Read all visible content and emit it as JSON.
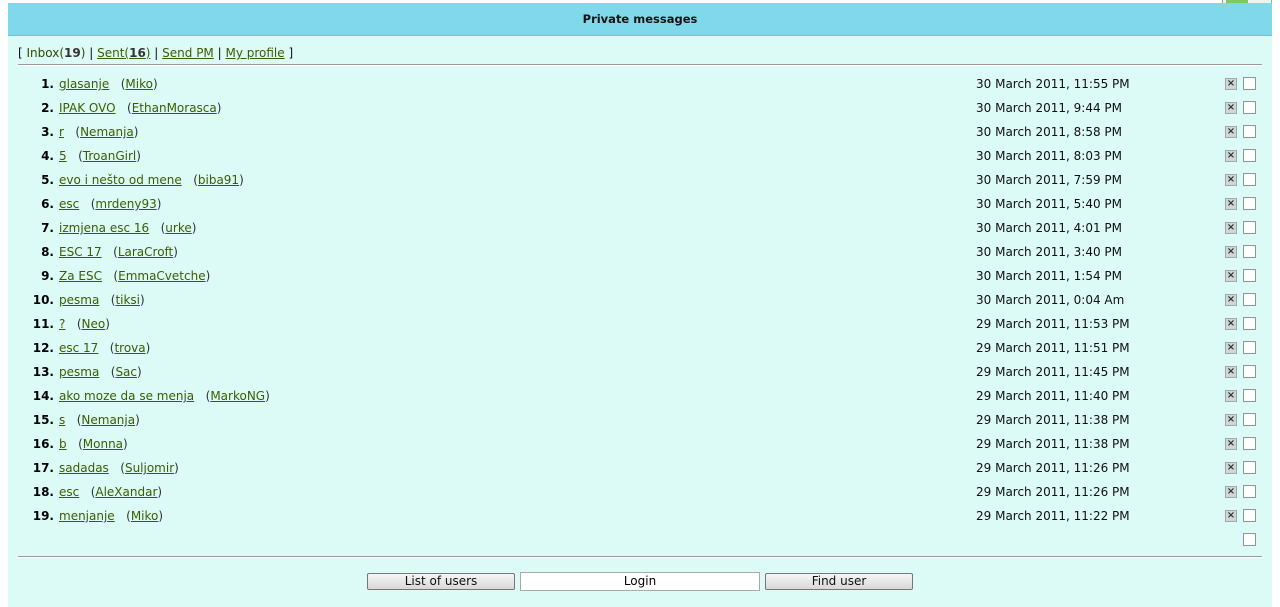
{
  "header": {
    "title": "Private messages"
  },
  "nav": {
    "inbox_label": "Inbox",
    "inbox_count": "19",
    "sent_label": "Sent",
    "sent_count": "16",
    "send_pm": "Send PM",
    "my_profile": "My profile"
  },
  "messages": [
    {
      "num": "1.",
      "subject": "glasanje",
      "sender": "Miko",
      "date": "30 March 2011, 11:55 PM"
    },
    {
      "num": "2.",
      "subject": "IPAK OVO",
      "sender": "EthanMorasca",
      "date": "30 March 2011, 9:44 PM"
    },
    {
      "num": "3.",
      "subject": "r",
      "sender": "Nemanja",
      "date": "30 March 2011, 8:58 PM"
    },
    {
      "num": "4.",
      "subject": "5",
      "sender": "TroanGirl",
      "date": "30 March 2011, 8:03 PM"
    },
    {
      "num": "5.",
      "subject": "evo i nešto od mene",
      "sender": "biba91",
      "date": "30 March 2011, 7:59 PM"
    },
    {
      "num": "6.",
      "subject": "esc",
      "sender": "mrdeny93",
      "date": "30 March 2011, 5:40 PM"
    },
    {
      "num": "7.",
      "subject": "izmjena esc 16",
      "sender": "urke",
      "date": "30 March 2011, 4:01 PM"
    },
    {
      "num": "8.",
      "subject": "ESC 17",
      "sender": "LaraCroft",
      "date": "30 March 2011, 3:40 PM"
    },
    {
      "num": "9.",
      "subject": "Za ESC",
      "sender": "EmmaCvetche",
      "date": "30 March 2011, 1:54 PM"
    },
    {
      "num": "10.",
      "subject": "pesma",
      "sender": "tiksi",
      "date": "30 March 2011, 0:04 Am"
    },
    {
      "num": "11.",
      "subject": "?",
      "sender": "Neo",
      "date": "29 March 2011, 11:53 PM"
    },
    {
      "num": "12.",
      "subject": "esc 17",
      "sender": "trova",
      "date": "29 March 2011, 11:51 PM"
    },
    {
      "num": "13.",
      "subject": "pesma",
      "sender": "Sac",
      "date": "29 March 2011, 11:45 PM"
    },
    {
      "num": "14.",
      "subject": "ako moze da se menja",
      "sender": "MarkoNG",
      "date": "29 March 2011, 11:40 PM"
    },
    {
      "num": "15.",
      "subject": "s",
      "sender": "Nemanja",
      "date": "29 March 2011, 11:38 PM"
    },
    {
      "num": "16.",
      "subject": "b",
      "sender": "Monna",
      "date": "29 March 2011, 11:38 PM"
    },
    {
      "num": "17.",
      "subject": "sadadas",
      "sender": "Suljomir",
      "date": "29 March 2011, 11:26 PM"
    },
    {
      "num": "18.",
      "subject": "esc",
      "sender": "AleXandar",
      "date": "29 March 2011, 11:26 PM"
    },
    {
      "num": "19.",
      "subject": "menjanje",
      "sender": "Miko",
      "date": "29 March 2011, 11:22 PM"
    }
  ],
  "icons": {
    "delete": "x-delete-icon"
  },
  "footer": {
    "list_users": "List of users",
    "login": "Login",
    "find_user": "Find user"
  },
  "colors": {
    "header_bg": "#7fd9ea",
    "panel_bg": "#dcfaf6",
    "link": "#3b5e00"
  }
}
